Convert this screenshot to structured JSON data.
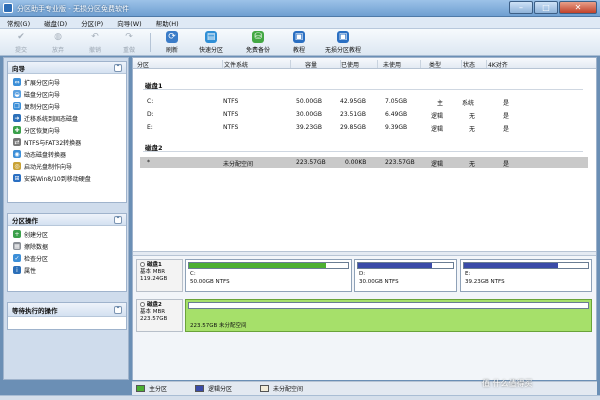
{
  "window": {
    "title": "分区助手专业版 - 无损分区免费软件"
  },
  "menu": [
    "常规(G)",
    "磁盘(D)",
    "分区(P)",
    "向导(W)",
    "帮助(H)"
  ],
  "toolbar": {
    "buttons": [
      {
        "label": "提交",
        "icon": "check-icon",
        "enabled": false
      },
      {
        "label": "放弃",
        "icon": "discard-icon",
        "enabled": false
      },
      {
        "label": "撤销",
        "icon": "undo-icon",
        "enabled": false
      },
      {
        "label": "重做",
        "icon": "redo-icon",
        "enabled": false
      },
      {
        "label": "刷新",
        "icon": "refresh-icon",
        "enabled": true
      },
      {
        "label": "快速分区",
        "icon": "quick-partition-icon",
        "enabled": true
      },
      {
        "label": "免费备份",
        "icon": "backup-icon",
        "enabled": true
      },
      {
        "label": "教程",
        "icon": "tutorial-icon",
        "enabled": true
      },
      {
        "label": "无损分区教程",
        "icon": "lossless-tutorial-icon",
        "enabled": true
      }
    ]
  },
  "wizard_panel": {
    "title": "向导",
    "items": [
      "扩展分区向导",
      "磁盘分区向导",
      "复制分区向导",
      "迁移系统到固态磁盘",
      "分区恢复向导",
      "NTFS与FAT32转换器",
      "动态磁盘转换器",
      "启动光盘制作向导",
      "安装Win8/10到移动硬盘"
    ]
  },
  "ops_panel": {
    "title": "分区操作",
    "items": [
      "创建分区",
      "擦除数据",
      "检查分区",
      "属性"
    ]
  },
  "pending_panel": {
    "title": "等待执行的操作"
  },
  "table": {
    "headers": [
      "分区",
      "文件系统",
      "容量",
      "已使用",
      "未使用",
      "类型",
      "状态",
      "4K对齐"
    ],
    "disk1_label": "磁盘1",
    "disk2_label": "磁盘2",
    "disk1_rows": [
      [
        "C:",
        "NTFS",
        "50.00GB",
        "42.95GB",
        "7.05GB",
        "主",
        "系统",
        "是"
      ],
      [
        "D:",
        "NTFS",
        "30.00GB",
        "23.51GB",
        "6.49GB",
        "逻辑",
        "无",
        "是"
      ],
      [
        "E:",
        "NTFS",
        "39.23GB",
        "29.85GB",
        "9.39GB",
        "逻辑",
        "无",
        "是"
      ]
    ],
    "disk2_rows": [
      [
        "*",
        "未分配空间",
        "223.57GB",
        "0.00KB",
        "223.57GB",
        "逻辑",
        "无",
        "是"
      ]
    ]
  },
  "disk_map": {
    "disk1": {
      "name": "磁盘1",
      "type": "基本 MBR",
      "size": "119.24GB"
    },
    "disk1_parts": [
      {
        "letter": "C:",
        "detail": "50.00GB NTFS",
        "used_fraction": 0.86
      },
      {
        "letter": "D:",
        "detail": "30.00GB NTFS",
        "used_fraction": 0.78
      },
      {
        "letter": "E:",
        "detail": "39.23GB NTFS",
        "used_fraction": 0.76
      }
    ],
    "disk2": {
      "name": "磁盘2",
      "type": "基本 MBR",
      "size": "223.57GB"
    },
    "disk2_parts": [
      {
        "detail": "223.57GB 未分配空间",
        "used_fraction": 0
      }
    ]
  },
  "legend": [
    {
      "label": "主分区",
      "color": "#4caf32"
    },
    {
      "label": "逻辑分区",
      "color": "#3a4ba8"
    },
    {
      "label": "未分配空间",
      "color": "#f3ecd8"
    }
  ],
  "colors": {
    "primary": "#4caf32",
    "logical": "#3a4ba8",
    "unallocated_highlight": "#a6e06a"
  },
  "watermark": "值 什么值得买"
}
